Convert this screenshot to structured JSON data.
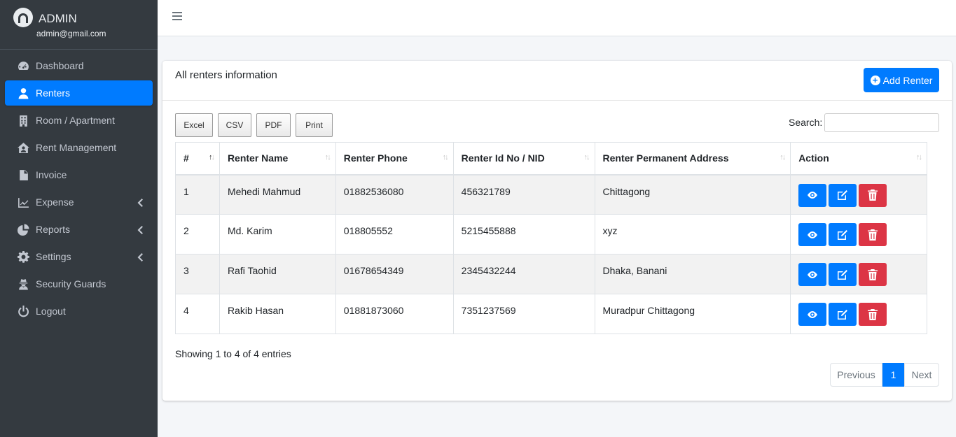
{
  "brand": {
    "name": "ADMIN",
    "email": "admin@gmail.com"
  },
  "sidebar": {
    "items": [
      {
        "label": "Dashboard",
        "icon": "tachometer-icon"
      },
      {
        "label": "Renters",
        "icon": "user-icon",
        "active": true
      },
      {
        "label": "Room / Apartment",
        "icon": "building-icon"
      },
      {
        "label": "Rent Management",
        "icon": "house-user-icon"
      },
      {
        "label": "Invoice",
        "icon": "file-invoice-icon"
      },
      {
        "label": "Expense",
        "icon": "chart-line-icon",
        "submenu": true
      },
      {
        "label": "Reports",
        "icon": "chart-pie-icon",
        "submenu": true
      },
      {
        "label": "Settings",
        "icon": "gear-icon",
        "submenu": true
      },
      {
        "label": "Security Guards",
        "icon": "user-secret-icon"
      },
      {
        "label": "Logout",
        "icon": "power-icon"
      }
    ]
  },
  "card": {
    "title": "All renters information",
    "add_label": "Add Renter"
  },
  "export": {
    "excel": "Excel",
    "csv": "CSV",
    "pdf": "PDF",
    "print": "Print"
  },
  "search": {
    "label": "Search:"
  },
  "table": {
    "headers": [
      "#",
      "Renter Name",
      "Renter Phone",
      "Renter Id No / NID",
      "Renter Permanent Address",
      "Action"
    ],
    "rows": [
      {
        "num": "1",
        "name": "Mehedi Mahmud",
        "phone": "01882536080",
        "nid": "456321789",
        "address": "Chittagong"
      },
      {
        "num": "2",
        "name": "Md. Karim",
        "phone": "018805552",
        "nid": "5215455888",
        "address": "xyz"
      },
      {
        "num": "3",
        "name": "Rafi Taohid",
        "phone": "01678654349",
        "nid": "2345432244",
        "address": "Dhaka, Banani"
      },
      {
        "num": "4",
        "name": "Rakib Hasan",
        "phone": "01881873060",
        "nid": "7351237569",
        "address": "Muradpur Chittagong"
      }
    ]
  },
  "footer": {
    "showing": "Showing 1 to 4 of 4 entries",
    "previous": "Previous",
    "page": "1",
    "next": "Next"
  },
  "colors": {
    "primary": "#007bff",
    "danger": "#dc3545",
    "sidebar": "#343a40"
  }
}
